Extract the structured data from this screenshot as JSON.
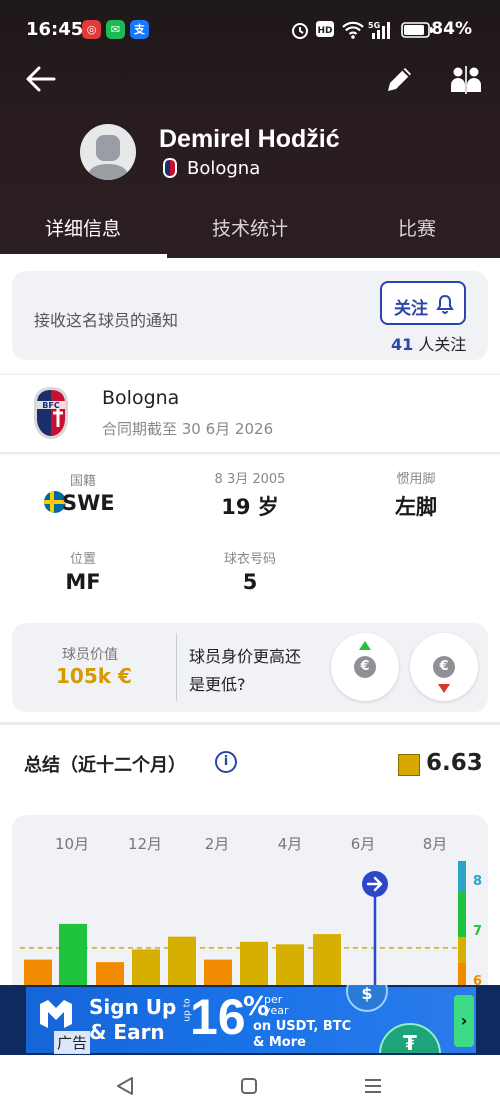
{
  "status_bar": {
    "time": "16:45",
    "battery": "84%",
    "app_icons": [
      "weibo-icon",
      "wechat-icon",
      "alipay-icon"
    ],
    "network": "5G"
  },
  "player": {
    "name": "Demirel Hodžić",
    "club": "Bologna"
  },
  "tabs": [
    {
      "label": "详细信息",
      "active": true
    },
    {
      "label": "技术统计",
      "active": false
    },
    {
      "label": "比赛",
      "active": false
    }
  ],
  "notify": {
    "text": "接收这名球员的通知",
    "follow_label": "关注",
    "followers_count": "41",
    "followers_suffix": " 人关注"
  },
  "club": {
    "name": "Bologna",
    "contract": "合同期截至 30 6月 2026"
  },
  "info": {
    "nationality_label": "国籍",
    "nationality": "SWE",
    "dob_label": "8 3月 2005",
    "age": "19 岁",
    "foot_label": "惯用脚",
    "foot": "左脚",
    "position_label": "位置",
    "position": "MF",
    "shirt_label": "球衣号码",
    "shirt": "5"
  },
  "market_value": {
    "label": "球员价值",
    "value": "105k €",
    "question_line1": "球员身价更高还",
    "question_line2": "是更低?",
    "euro_symbol": "€"
  },
  "summary": {
    "title": "总结（近十二个月）",
    "info_symbol": "i",
    "rating": "6.63",
    "rating_color": "#d6a800"
  },
  "chart_data": {
    "type": "bar",
    "x_ticks": [
      "10月",
      "12月",
      "2月",
      "4月",
      "6月",
      "8月"
    ],
    "values": [
      6.4,
      7.1,
      6.35,
      6.6,
      6.85,
      6.4,
      6.75,
      6.7,
      6.9
    ],
    "colors": [
      "#f08a00",
      "#1fc43c",
      "#f08a00",
      "#d6b000",
      "#d6b000",
      "#f08a00",
      "#d6b000",
      "#d6b000",
      "#d6b000"
    ],
    "average": 6.63,
    "y_labels": [
      "8",
      "7",
      "6"
    ],
    "scale_colors": [
      "#2ea3c8",
      "#1fc43c",
      "#d6b000",
      "#f08a00"
    ],
    "current_marker": "6月"
  },
  "ad": {
    "line1": "Sign Up",
    "line2": "& Earn",
    "up_to": "up to",
    "percent": "16",
    "percent_sign": "%",
    "per": "per",
    "year": "year",
    "usdt": "on USDT, BTC",
    "more": "& More",
    "tag": "广告",
    "arrow": "›"
  }
}
